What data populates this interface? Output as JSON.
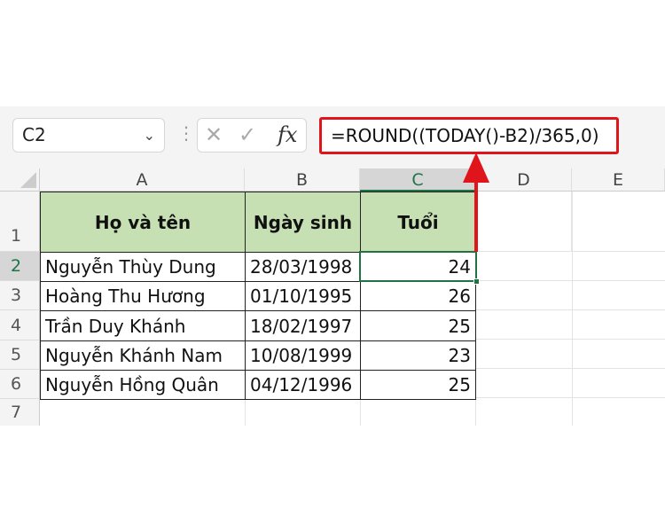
{
  "name_box": {
    "value": "C2"
  },
  "formula_bar": {
    "cancel": "✕",
    "enter": "✓",
    "fx": "fx",
    "formula": "=ROUND((TODAY()-B2)/365,0)"
  },
  "columns": [
    "A",
    "B",
    "C",
    "D",
    "E"
  ],
  "rows": [
    "1",
    "2",
    "3",
    "4",
    "5",
    "6",
    "7"
  ],
  "headers": [
    "Họ và tên",
    "Ngày sinh",
    "Tuổi"
  ],
  "data": [
    [
      "Nguyễn Thùy Dung",
      "28/03/1998",
      "24"
    ],
    [
      "Hoàng Thu Hương",
      "01/10/1995",
      "26"
    ],
    [
      "Trần Duy Khánh",
      "18/02/1997",
      "25"
    ],
    [
      "Nguyễn Khánh Nam",
      "10/08/1999",
      "23"
    ],
    [
      "Nguyễn Hồng Quân",
      "04/12/1996",
      "25"
    ]
  ],
  "colors": {
    "header_fill": "#c6e0b4",
    "highlight": "#e0151b",
    "selection": "#217346"
  }
}
